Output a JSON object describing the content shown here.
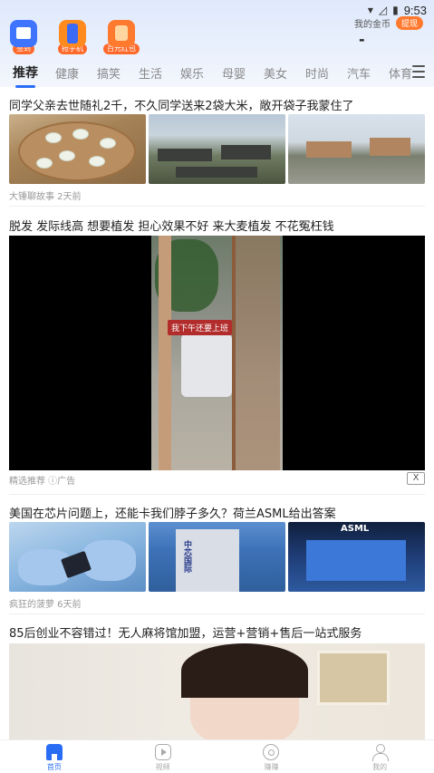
{
  "status_bar": {
    "time": "9:53"
  },
  "quick_actions": [
    {
      "label": "签到",
      "icon": "calendar-icon"
    },
    {
      "label": "抢手机",
      "icon": "phone-icon"
    },
    {
      "label": "百元红包",
      "icon": "red-packet-icon"
    }
  ],
  "coins": {
    "label": "我的金币",
    "withdraw": "提现",
    "value": "-"
  },
  "tabs": [
    "推荐",
    "健康",
    "搞笑",
    "生活",
    "娱乐",
    "母婴",
    "美女",
    "时尚",
    "汽车",
    "体育"
  ],
  "feed": [
    {
      "title": "同学父亲去世随礼2千，不久同学送来2袋大米，敞开袋子我蒙住了",
      "meta": "大锤聊故事 2天前"
    },
    {
      "title": "脱发 发际线高 想要植发 担心效果不好 来大麦植发 不花冤枉钱",
      "video_caption": "我下午还要上班",
      "ad_meta": "精选推荐 ⓘ广告",
      "close": "X"
    },
    {
      "title": "美国在芯片问题上，还能卡我们脖子多久？荷兰ASML给出答案",
      "meta": "疯狂的菠萝 6天前",
      "thumb_texts": [
        "中芯国际",
        "ASML"
      ]
    },
    {
      "title": "85后创业不容错过！无人麻将馆加盟，运营+营销+售后一站式服务"
    }
  ],
  "bottom_nav": [
    {
      "label": "首页",
      "icon": "home-icon",
      "active": true
    },
    {
      "label": "视频",
      "icon": "video-icon",
      "active": false
    },
    {
      "label": "赚赚",
      "icon": "earn-icon",
      "active": false
    },
    {
      "label": "我的",
      "icon": "profile-icon",
      "active": false
    }
  ],
  "colors": {
    "accent": "#2a6df5",
    "badge": "#ff6a2b"
  }
}
